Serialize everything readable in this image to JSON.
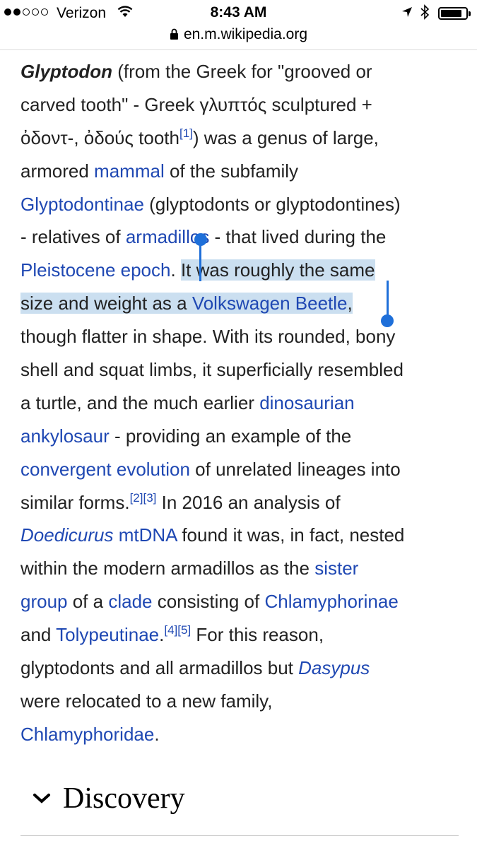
{
  "status_bar": {
    "carrier": "Verizon",
    "time": "8:43 AM",
    "signal_bars_filled": 2,
    "signal_bars_total": 5,
    "battery_level": 0.85
  },
  "browser": {
    "url": "en.m.wikipedia.org"
  },
  "article": {
    "l01_title": "Glyptodon",
    "l01_rest": " (from the Greek for \"grooved or",
    "l02": "carved tooth\" - Greek γλυπτός sculptured +",
    "l03_a": "ὀδοντ-, ὀδούς tooth",
    "ref1": "[1]",
    "l03_b": ") was a genus of large,",
    "l04_a": "armored ",
    "link_mammal": "mammal",
    "l04_b": " of the subfamily",
    "link_glyptodontinae": "Glyptodontinae",
    "l05_b": " (glyptodonts or glyptodontines)",
    "l06_a": "- relatives of ",
    "link_armadillos": "armadillos",
    "l06_b": " - that lived during the",
    "link_pleistocene": "Pleistocene epoch",
    "l07_b": ". ",
    "l07_sel": "It was roughly the same",
    "l08_sel": "size and weight as a ",
    "link_beetle": "Volkswagen Beetle",
    "l08_comma": ",",
    "l09": "though flatter in shape. With its rounded, bony",
    "l10": "shell and squat limbs, it superficially resembled",
    "l11_a": "a turtle, and the much earlier ",
    "link_dinosaurian": "dinosaurian",
    "link_ankylosaur": "ankylosaur",
    "l12_b": " - providing an example of the",
    "link_convergent": "convergent evolution",
    "l13_b": " of unrelated lineages into",
    "l14_a": "similar forms.",
    "ref2": "[2]",
    "ref3": "[3]",
    "l14_b": " In 2016 an analysis of",
    "link_doedicurus": "Doedicurus",
    "l15_sp": " ",
    "link_mtdna": "mtDNA",
    "l15_b": " found it was, in fact, nested",
    "l16_a": "within the modern armadillos as the ",
    "link_sister": "sister",
    "link_group": "group",
    "l17_b": " of a ",
    "link_clade": "clade",
    "l17_c": " consisting of ",
    "link_chlamyphorinae": "Chlamyphorinae",
    "l18_a": "and ",
    "link_tolypeutinae": "Tolypeutinae",
    "l18_dot": ".",
    "ref4": "[4]",
    "ref5": "[5]",
    "l18_b": " For this reason,",
    "l19_a": "glyptodonts and all armadillos but ",
    "link_dasypus": "Dasypus",
    "l20": "were relocated to a new family,",
    "link_chlamyphoridae": "Chlamyphoridae",
    "l21_dot": "."
  },
  "section": {
    "title": "Discovery"
  },
  "colors": {
    "link": "#1f48b3",
    "selection": "#cbdff0",
    "handle": "#1e6fd9"
  },
  "icons": [
    "signal-dots",
    "wifi-icon",
    "location-arrow-icon",
    "bluetooth-icon",
    "battery-icon",
    "lock-icon",
    "chevron-down-icon"
  ]
}
